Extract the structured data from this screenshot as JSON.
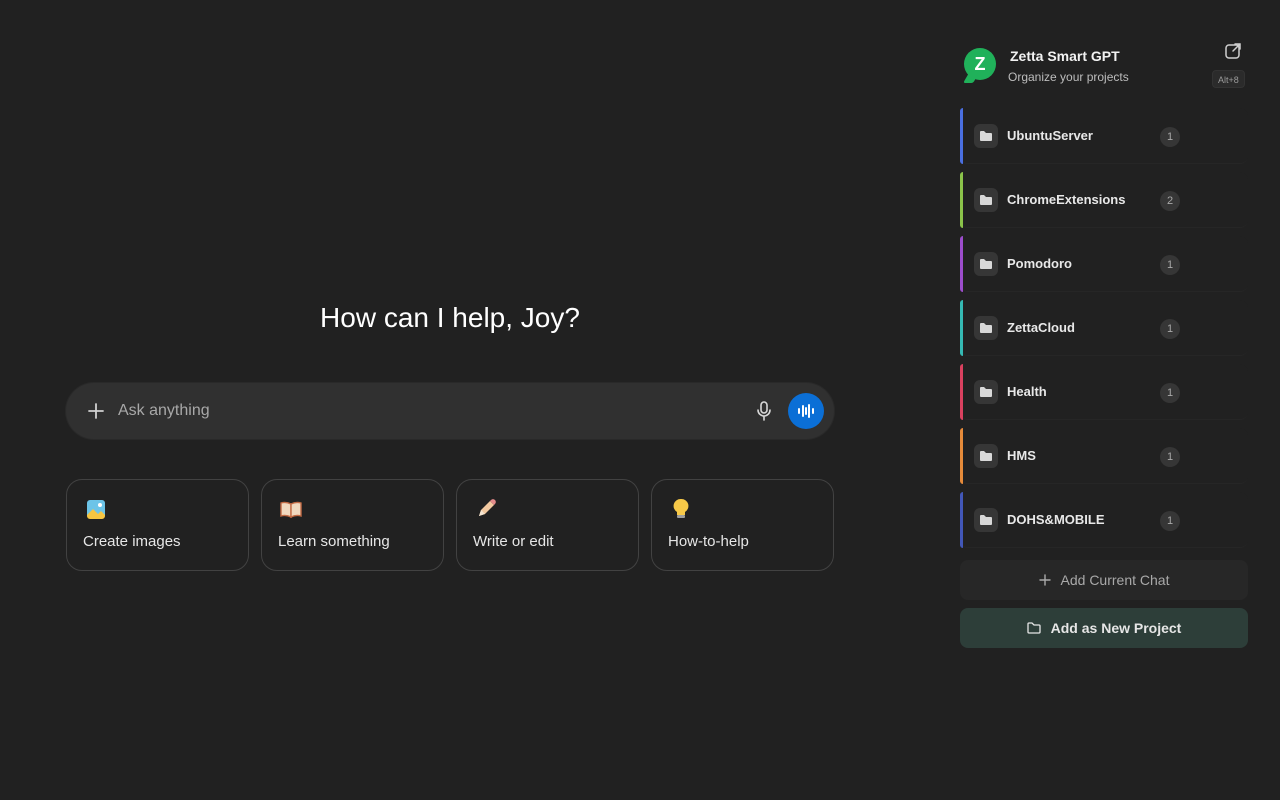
{
  "greeting": "How can I help, Joy?",
  "composer": {
    "placeholder": "Ask anything",
    "voice_color": "#0b6fd6"
  },
  "cards": [
    {
      "label": "Create images",
      "icon": "image-icon"
    },
    {
      "label": "Learn something",
      "icon": "book-icon"
    },
    {
      "label": "Write or edit",
      "icon": "pencil-icon"
    },
    {
      "label": "How-to-help",
      "icon": "lightbulb-icon"
    }
  ],
  "sidebar": {
    "logo_letter": "Z",
    "title": "Zetta Smart GPT",
    "subtitle": "Organize your projects",
    "shortcut": "Alt+8",
    "projects": [
      {
        "name": "UbuntuServer",
        "count": "1",
        "color": "#4a6fe0"
      },
      {
        "name": "ChromeExtensions",
        "count": "2",
        "color": "#8bc34a"
      },
      {
        "name": "Pomodoro",
        "count": "1",
        "color": "#9c4dcc"
      },
      {
        "name": "ZettaCloud",
        "count": "1",
        "color": "#35b9b3"
      },
      {
        "name": "Health",
        "count": "1",
        "color": "#d9415f"
      },
      {
        "name": "HMS",
        "count": "1",
        "color": "#e58a3a"
      },
      {
        "name": "DOHS&MOBILE",
        "count": "1",
        "color": "#4257b8"
      }
    ],
    "add_current_chat": "Add Current Chat",
    "add_new_project": "Add as New Project"
  }
}
